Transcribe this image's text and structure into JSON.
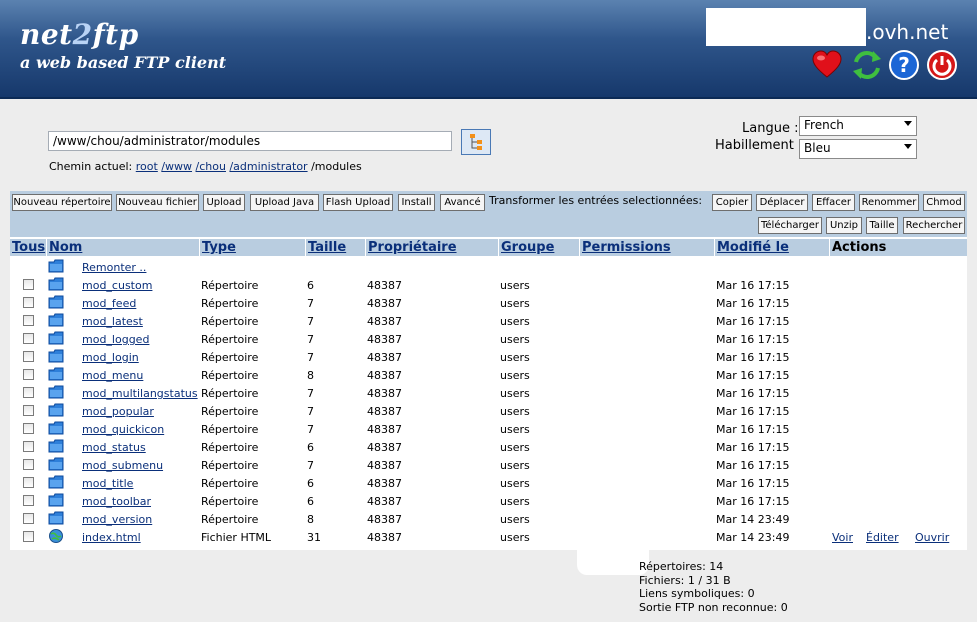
{
  "header": {
    "logo_line1_a": "net",
    "logo_line1_b": "2",
    "logo_line1_c": "ftp",
    "logo_line2": "a web based FTP client",
    "host_suffix": ".ovh.net",
    "icons": [
      "heart-icon",
      "refresh-icon",
      "help-icon",
      "power-icon"
    ]
  },
  "path": {
    "value": "/www/chou/administrator/modules",
    "current_label": "Chemin actuel:",
    "crumbs": [
      "root",
      "/www",
      "/chou",
      "/administrator"
    ],
    "last": "/modules"
  },
  "settings": {
    "language_label": "Langue :",
    "language_value": "French",
    "skin_label": "Habillement :",
    "skin_value": "Bleu"
  },
  "toolbar": {
    "row1": [
      "Nouveau répertoire",
      "Nouveau fichier",
      "Upload",
      "Upload Java",
      "Flash Upload",
      "Install",
      "Avancé"
    ],
    "transform_label": "Transformer les entrées selectionnées:",
    "row1_right": [
      "Copier",
      "Déplacer",
      "Effacer",
      "Renommer",
      "Chmod"
    ],
    "row2_right": [
      "Télécharger",
      "Unzip",
      "Taille",
      "Rechercher"
    ]
  },
  "table": {
    "headers": {
      "all": "Tous",
      "name": "Nom",
      "type": "Type",
      "size": "Taille",
      "owner": "Propriétaire",
      "group": "Groupe",
      "permissions": "Permissions",
      "modified": "Modifié le",
      "actions": "Actions"
    },
    "up_link": "Remonter ..",
    "rows": [
      {
        "name": "mod_custom",
        "type": "Répertoire",
        "size": "6",
        "owner": "48387",
        "group": "users",
        "modified": "Mar 16 17:15"
      },
      {
        "name": "mod_feed",
        "type": "Répertoire",
        "size": "7",
        "owner": "48387",
        "group": "users",
        "modified": "Mar 16 17:15"
      },
      {
        "name": "mod_latest",
        "type": "Répertoire",
        "size": "7",
        "owner": "48387",
        "group": "users",
        "modified": "Mar 16 17:15"
      },
      {
        "name": "mod_logged",
        "type": "Répertoire",
        "size": "7",
        "owner": "48387",
        "group": "users",
        "modified": "Mar 16 17:15"
      },
      {
        "name": "mod_login",
        "type": "Répertoire",
        "size": "7",
        "owner": "48387",
        "group": "users",
        "modified": "Mar 16 17:15"
      },
      {
        "name": "mod_menu",
        "type": "Répertoire",
        "size": "8",
        "owner": "48387",
        "group": "users",
        "modified": "Mar 16 17:15"
      },
      {
        "name": "mod_multilangstatus",
        "type": "Répertoire",
        "size": "7",
        "owner": "48387",
        "group": "users",
        "modified": "Mar 16 17:15"
      },
      {
        "name": "mod_popular",
        "type": "Répertoire",
        "size": "7",
        "owner": "48387",
        "group": "users",
        "modified": "Mar 16 17:15"
      },
      {
        "name": "mod_quickicon",
        "type": "Répertoire",
        "size": "7",
        "owner": "48387",
        "group": "users",
        "modified": "Mar 16 17:15"
      },
      {
        "name": "mod_status",
        "type": "Répertoire",
        "size": "6",
        "owner": "48387",
        "group": "users",
        "modified": "Mar 16 17:15"
      },
      {
        "name": "mod_submenu",
        "type": "Répertoire",
        "size": "7",
        "owner": "48387",
        "group": "users",
        "modified": "Mar 16 17:15"
      },
      {
        "name": "mod_title",
        "type": "Répertoire",
        "size": "6",
        "owner": "48387",
        "group": "users",
        "modified": "Mar 16 17:15"
      },
      {
        "name": "mod_toolbar",
        "type": "Répertoire",
        "size": "6",
        "owner": "48387",
        "group": "users",
        "modified": "Mar 16 17:15"
      },
      {
        "name": "mod_version",
        "type": "Répertoire",
        "size": "8",
        "owner": "48387",
        "group": "users",
        "modified": "Mar 14 23:49"
      },
      {
        "name": "index.html",
        "type": "Fichier HTML",
        "size": "31",
        "owner": "48387",
        "group": "users",
        "modified": "Mar 14 23:49",
        "actions": [
          "Voir",
          "Éditer",
          "Ouvrir"
        ]
      }
    ]
  },
  "summary": {
    "dirs": "Répertoires: 14",
    "files": "Fichiers: 1 / 31 B",
    "symlinks": "Liens symboliques: 0",
    "unrecognized": "Sortie FTP non reconnue: 0"
  },
  "colors": {
    "header_dark": "#16386b",
    "toolbar_bg": "#b9cde0",
    "link": "#0a2f7a",
    "page_bg": "#ededed"
  }
}
